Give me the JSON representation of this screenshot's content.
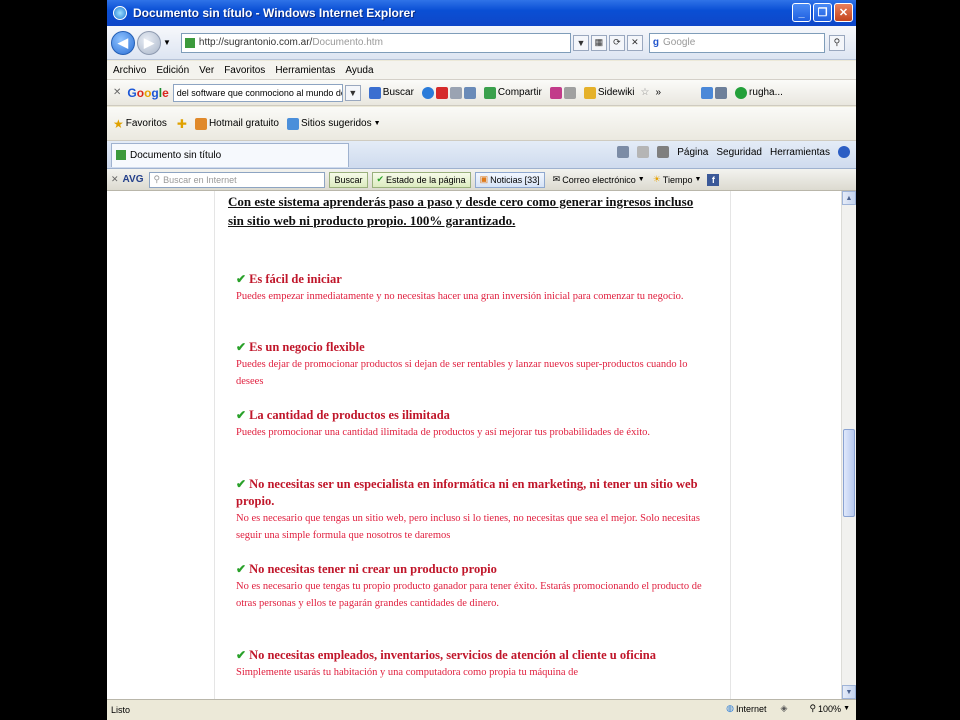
{
  "window": {
    "title": "Documento sin título - Windows Internet Explorer"
  },
  "address": {
    "url_host": "http://sugrantonio.com.ar/",
    "url_page": "Documento.htm",
    "search_placeholder": "Google"
  },
  "menu": [
    "Archivo",
    "Edición",
    "Ver",
    "Favoritos",
    "Herramientas",
    "Ayuda"
  ],
  "google_toolbar": {
    "search_text": "del software que conmociono al mundo de los",
    "buscar": "Buscar",
    "compartir": "Compartir",
    "sidewiki": "Sidewiki",
    "user": "rugha..."
  },
  "favorites_bar": {
    "favoritos": "Favoritos",
    "hotmail": "Hotmail gratuito",
    "sitios": "Sitios sugeridos"
  },
  "tab": {
    "title": "Documento sin título"
  },
  "command_bar": {
    "pagina": "Página",
    "seguridad": "Seguridad",
    "herramientas": "Herramientas"
  },
  "avg_toolbar": {
    "logo": "AVG",
    "search_placeholder": "Buscar en Internet",
    "buscar": "Buscar",
    "estado": "Estado de la página",
    "noticias": "Noticias [33]",
    "correo": "Correo electrónico",
    "tiempo": "Tiempo"
  },
  "content": {
    "headline": "Con este sistema aprenderás paso a paso y desde cero como generar ingresos incluso sin sitio web ni producto propio. 100% garantizado.",
    "features": [
      {
        "title": "Es fácil de iniciar",
        "desc": "Puedes empezar inmediatamente y no necesitas hacer una gran inversión inicial para comenzar tu negocio."
      },
      {
        "title": "Es un negocio flexible",
        "desc": "Puedes dejar de promocionar productos si dejan de ser rentables y lanzar nuevos super-productos cuando lo desees"
      },
      {
        "title": "La cantidad de productos es ilimitada",
        "desc": "Puedes promocionar una cantidad ilimitada de productos y así mejorar tus probabilidades de éxito."
      },
      {
        "title": "No necesitas ser un especialista en informática ni en marketing, ni tener un sitio web propio.",
        "desc": "No es necesario que tengas un sitio web, pero incluso si lo tienes, no necesitas que sea el mejor. Solo necesitas seguir una simple formula que nosotros te daremos"
      },
      {
        "title": "No necesitas tener ni crear un producto propio",
        "desc": "No es necesario que tengas tu propio producto ganador para tener éxito. Estarás promocionando el producto de otras personas y ellos te pagarán grandes cantidades de dinero."
      },
      {
        "title": "No necesitas empleados, inventarios, servicios de atención al cliente u oficina",
        "desc": "Simplemente usarás tu habitación y una computadora como propia tu máquina de"
      }
    ]
  },
  "status": {
    "left": "Listo",
    "zone": "Internet",
    "zoom": "100%"
  },
  "colors": {
    "title_blue": "#0a4fd4",
    "feature_title": "#c0162a",
    "feature_desc": "#e0203f",
    "check_green": "#2aa12a"
  }
}
